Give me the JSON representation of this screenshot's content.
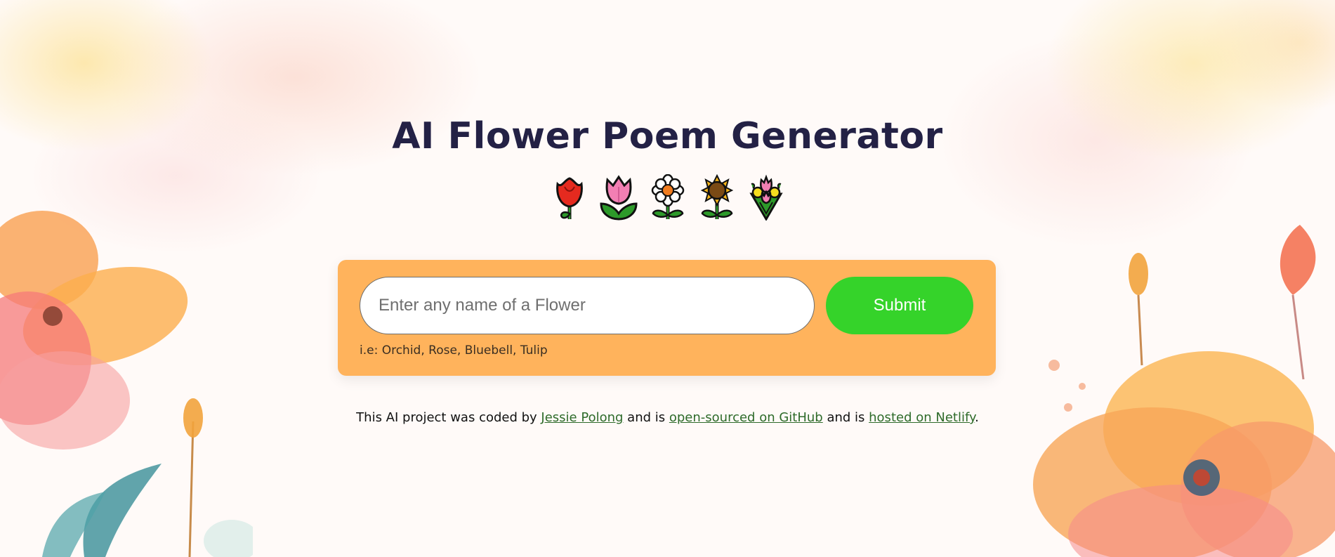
{
  "page": {
    "title": "AI Flower Poem Generator",
    "emojis": [
      "rose-icon",
      "tulip-icon",
      "blossom-icon",
      "sunflower-icon",
      "bouquet-icon"
    ]
  },
  "form": {
    "input_value": "",
    "input_placeholder": "Enter any name of a Flower",
    "submit_label": "Submit",
    "hint": "i.e: Orchid, Rose, Bluebell, Tulip"
  },
  "footer": {
    "text_before": "This AI project was coded by ",
    "author_link": "Jessie Polong",
    "text_middle_1": " and is ",
    "github_link": "open-sourced on GitHub",
    "text_middle_2": " and is ",
    "netlify_link": "hosted on Netlify",
    "text_end": "."
  },
  "colors": {
    "title": "#232145",
    "card": "#ffb35c",
    "submit": "#35d32a",
    "link": "#2e6b2a"
  }
}
